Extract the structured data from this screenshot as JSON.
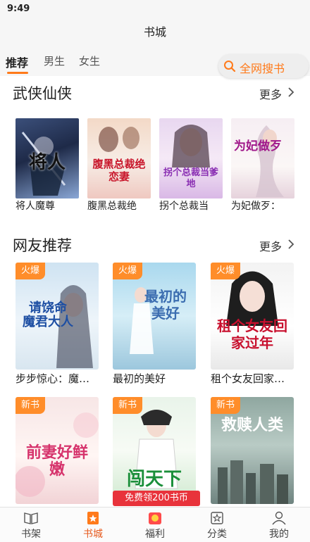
{
  "status_bar": {
    "time": "9:49"
  },
  "header": {
    "title": "书城"
  },
  "tabs": [
    {
      "label": "推荐",
      "active": true
    },
    {
      "label": "男生",
      "active": false
    },
    {
      "label": "女生",
      "active": false
    }
  ],
  "search": {
    "label": "全网搜书",
    "icon": "search-icon"
  },
  "sections": {
    "wuxia": {
      "title": "武侠仙侠",
      "more": "更多",
      "books": [
        {
          "title": "将人魔尊",
          "cover_text": "将人"
        },
        {
          "title": "腹黑总裁绝",
          "cover_text": "腹黑总裁绝恋妻"
        },
        {
          "title": "拐个总裁当",
          "cover_text": "拐个总裁当爹地"
        },
        {
          "title": "为妃做歹：",
          "cover_text": "为妃做歹"
        }
      ]
    },
    "recommend": {
      "title": "网友推荐",
      "more": "更多",
      "books": [
        {
          "title": "步步惊心：魔…",
          "badge": "火爆",
          "cover_text": "请饶命 魔君大人"
        },
        {
          "title": "最初的美好",
          "badge": "火爆",
          "cover_text": "最初的美好"
        },
        {
          "title": "租个女友回家…",
          "badge": "火爆",
          "cover_text": "租个女友回家过年"
        },
        {
          "badge": "新书",
          "cover_text": "前妻好鲜嫩"
        },
        {
          "badge": "新书",
          "cover_text": "闯天下"
        },
        {
          "badge": "新书",
          "cover_text": "救赎人类"
        }
      ]
    }
  },
  "promo": {
    "label": "免费领200书币"
  },
  "bottom_nav": [
    {
      "label": "书架",
      "icon": "bookshelf-icon",
      "active": false
    },
    {
      "label": "书城",
      "icon": "bookstore-icon",
      "active": true
    },
    {
      "label": "福利",
      "icon": "gift-icon",
      "active": false
    },
    {
      "label": "分类",
      "icon": "category-icon",
      "active": false
    },
    {
      "label": "我的",
      "icon": "profile-icon",
      "active": false
    }
  ],
  "colors": {
    "accent": "#ff7a1a",
    "badge": "#ff8d2a",
    "promo": "#e8333b",
    "nav_active": "#e65a1e"
  }
}
